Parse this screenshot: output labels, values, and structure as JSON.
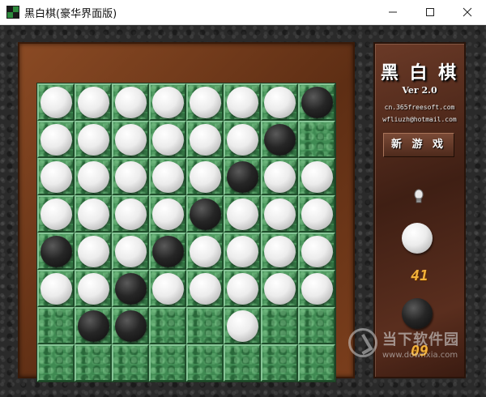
{
  "window": {
    "title": "黑白棋(豪华界面版)"
  },
  "board": {
    "size": 8,
    "rows": [
      [
        "W",
        "W",
        "W",
        "W",
        "W",
        "W",
        "W",
        "B"
      ],
      [
        "W",
        "W",
        "W",
        "W",
        "W",
        "W",
        "B",
        ""
      ],
      [
        "W",
        "W",
        "W",
        "W",
        "W",
        "B",
        "W",
        "W"
      ],
      [
        "W",
        "W",
        "W",
        "W",
        "B",
        "W",
        "W",
        "W"
      ],
      [
        "B",
        "W",
        "W",
        "B",
        "W",
        "W",
        "W",
        "W"
      ],
      [
        "W",
        "W",
        "B",
        "W",
        "W",
        "W",
        "W",
        "W"
      ],
      [
        "",
        "B",
        "B",
        "",
        "",
        "W",
        "",
        ""
      ],
      [
        "",
        "",
        "",
        "",
        "",
        "",
        "",
        ""
      ]
    ]
  },
  "panel": {
    "title": "黑 白 棋",
    "version": "Ver 2.0",
    "website": "cn.365freesoft.com",
    "email": "wfliuzh@hotmail.com",
    "new_game_label": "新 游 戏",
    "white_score": "41",
    "black_score": "09"
  },
  "watermark": {
    "text": "当下软件园",
    "url": "www.downxia.com"
  },
  "colors": {
    "board_green": "#3f8a52",
    "frame_brown": "#6e3a1c",
    "score_orange": "#f3b23a",
    "panel_brown": "#4a2418"
  },
  "icons": [
    "app-icon",
    "minimize-icon",
    "maximize-icon",
    "close-icon",
    "hint-bulb-icon",
    "watermark-logo-icon"
  ]
}
